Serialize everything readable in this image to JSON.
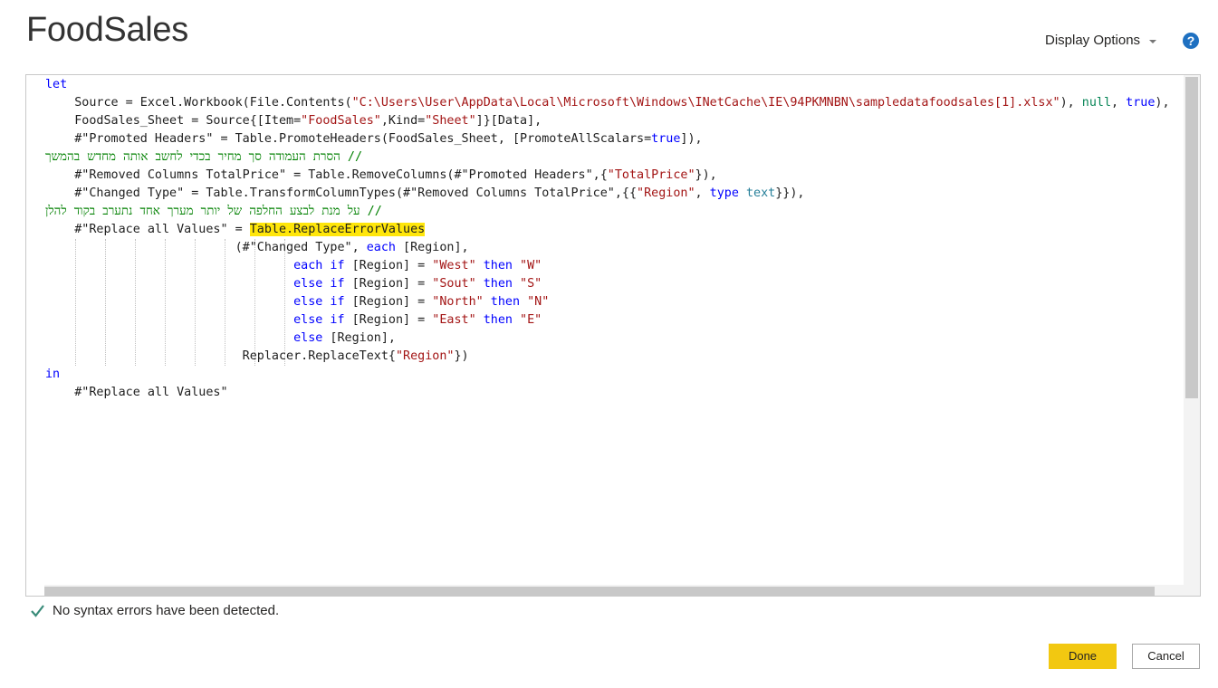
{
  "header": {
    "title": "FoodSales",
    "display_options_label": "Display Options",
    "help_icon": "question-circle-icon"
  },
  "editor": {
    "lines": [
      [
        {
          "t": "let",
          "c": "kw"
        }
      ],
      [
        {
          "t": "    Source = Excel.Workbook(File.Contents(",
          "c": "fn"
        },
        {
          "t": "\"C:\\Users\\User\\AppData\\Local\\Microsoft\\Windows\\INetCache\\IE\\94PKMNBN\\sampledatafoodsales[1].xlsx\"",
          "c": "str"
        },
        {
          "t": "), ",
          "c": "fn"
        },
        {
          "t": "null",
          "c": "num"
        },
        {
          "t": ", ",
          "c": "fn"
        },
        {
          "t": "true",
          "c": "kw"
        },
        {
          "t": "),",
          "c": "fn"
        }
      ],
      [
        {
          "t": "    FoodSales_Sheet = Source{[Item=",
          "c": "fn"
        },
        {
          "t": "\"FoodSales\"",
          "c": "str"
        },
        {
          "t": ",Kind=",
          "c": "fn"
        },
        {
          "t": "\"Sheet\"",
          "c": "str"
        },
        {
          "t": "]}[Data],",
          "c": "fn"
        }
      ],
      [
        {
          "t": "    #\"Promoted Headers\" = Table.PromoteHeaders(FoodSales_Sheet, [PromoteAllScalars=",
          "c": "fn"
        },
        {
          "t": "true",
          "c": "kw"
        },
        {
          "t": "]),",
          "c": "fn"
        }
      ],
      [
        {
          "t": "    // הסרת העמודה סך מחיר בכדי לחשב אותה מחדש בהמשך",
          "c": "cm"
        }
      ],
      [
        {
          "t": "    #\"Removed Columns TotalPrice\" = Table.RemoveColumns(#\"Promoted Headers\",{",
          "c": "fn"
        },
        {
          "t": "\"TotalPrice\"",
          "c": "str"
        },
        {
          "t": "}),",
          "c": "fn"
        }
      ],
      [
        {
          "t": "    #\"Changed Type\" = Table.TransformColumnTypes(#\"Removed Columns TotalPrice\",{{",
          "c": "fn"
        },
        {
          "t": "\"Region\"",
          "c": "str"
        },
        {
          "t": ", ",
          "c": "fn"
        },
        {
          "t": "type",
          "c": "kw"
        },
        {
          "t": " ",
          "c": "fn"
        },
        {
          "t": "text",
          "c": "typ"
        },
        {
          "t": "}}),",
          "c": "fn"
        }
      ],
      [
        {
          "t": "    // על מנת לבצע החלפה של יותר מערך אחד נתערב בקוד להלן",
          "c": "cm"
        }
      ],
      [
        {
          "t": "    #\"Replace all Values\" = ",
          "c": "fn"
        },
        {
          "t": "Table.ReplaceErrorValues",
          "c": "fn hl"
        }
      ],
      [
        {
          "t": "                          (#\"Changed Type\", ",
          "c": "fn"
        },
        {
          "t": "each",
          "c": "kw"
        },
        {
          "t": " [Region],",
          "c": "fn"
        }
      ],
      [
        {
          "t": "                                  ",
          "c": "fn"
        },
        {
          "t": "each",
          "c": "kw"
        },
        {
          "t": " ",
          "c": "fn"
        },
        {
          "t": "if",
          "c": "kw"
        },
        {
          "t": " [Region] = ",
          "c": "fn"
        },
        {
          "t": "\"West\"",
          "c": "str"
        },
        {
          "t": " ",
          "c": "fn"
        },
        {
          "t": "then",
          "c": "kw"
        },
        {
          "t": " ",
          "c": "fn"
        },
        {
          "t": "\"W\"",
          "c": "str"
        }
      ],
      [
        {
          "t": "                                  ",
          "c": "fn"
        },
        {
          "t": "else",
          "c": "kw"
        },
        {
          "t": " ",
          "c": "fn"
        },
        {
          "t": "if",
          "c": "kw"
        },
        {
          "t": " [Region] = ",
          "c": "fn"
        },
        {
          "t": "\"Sout\"",
          "c": "str"
        },
        {
          "t": " ",
          "c": "fn"
        },
        {
          "t": "then",
          "c": "kw"
        },
        {
          "t": " ",
          "c": "fn"
        },
        {
          "t": "\"S\"",
          "c": "str"
        }
      ],
      [
        {
          "t": "                                  ",
          "c": "fn"
        },
        {
          "t": "else",
          "c": "kw"
        },
        {
          "t": " ",
          "c": "fn"
        },
        {
          "t": "if",
          "c": "kw"
        },
        {
          "t": " [Region] = ",
          "c": "fn"
        },
        {
          "t": "\"North\"",
          "c": "str"
        },
        {
          "t": " ",
          "c": "fn"
        },
        {
          "t": "then",
          "c": "kw"
        },
        {
          "t": " ",
          "c": "fn"
        },
        {
          "t": "\"N\"",
          "c": "str"
        }
      ],
      [
        {
          "t": "                                  ",
          "c": "fn"
        },
        {
          "t": "else",
          "c": "kw"
        },
        {
          "t": " ",
          "c": "fn"
        },
        {
          "t": "if",
          "c": "kw"
        },
        {
          "t": " [Region] = ",
          "c": "fn"
        },
        {
          "t": "\"East\"",
          "c": "str"
        },
        {
          "t": " ",
          "c": "fn"
        },
        {
          "t": "then",
          "c": "kw"
        },
        {
          "t": " ",
          "c": "fn"
        },
        {
          "t": "\"E\"",
          "c": "str"
        }
      ],
      [
        {
          "t": "                                  ",
          "c": "fn"
        },
        {
          "t": "else",
          "c": "kw"
        },
        {
          "t": " [Region],",
          "c": "fn"
        }
      ],
      [
        {
          "t": "                           Replacer.ReplaceText{",
          "c": "fn"
        },
        {
          "t": "\"Region\"",
          "c": "str"
        },
        {
          "t": "})",
          "c": "fn"
        }
      ],
      [
        {
          "t": "in",
          "c": "kw"
        }
      ],
      [
        {
          "t": "    #\"Replace all Values\"",
          "c": "fn"
        }
      ]
    ]
  },
  "status": {
    "icon": "checkmark-icon",
    "message": "No syntax errors have been detected."
  },
  "footer": {
    "done_label": "Done",
    "cancel_label": "Cancel"
  },
  "colors": {
    "done_button": "#f2c811",
    "highlight": "#ffe60a",
    "keyword": "#0000ff",
    "string": "#a31515",
    "comment": "#008000"
  }
}
